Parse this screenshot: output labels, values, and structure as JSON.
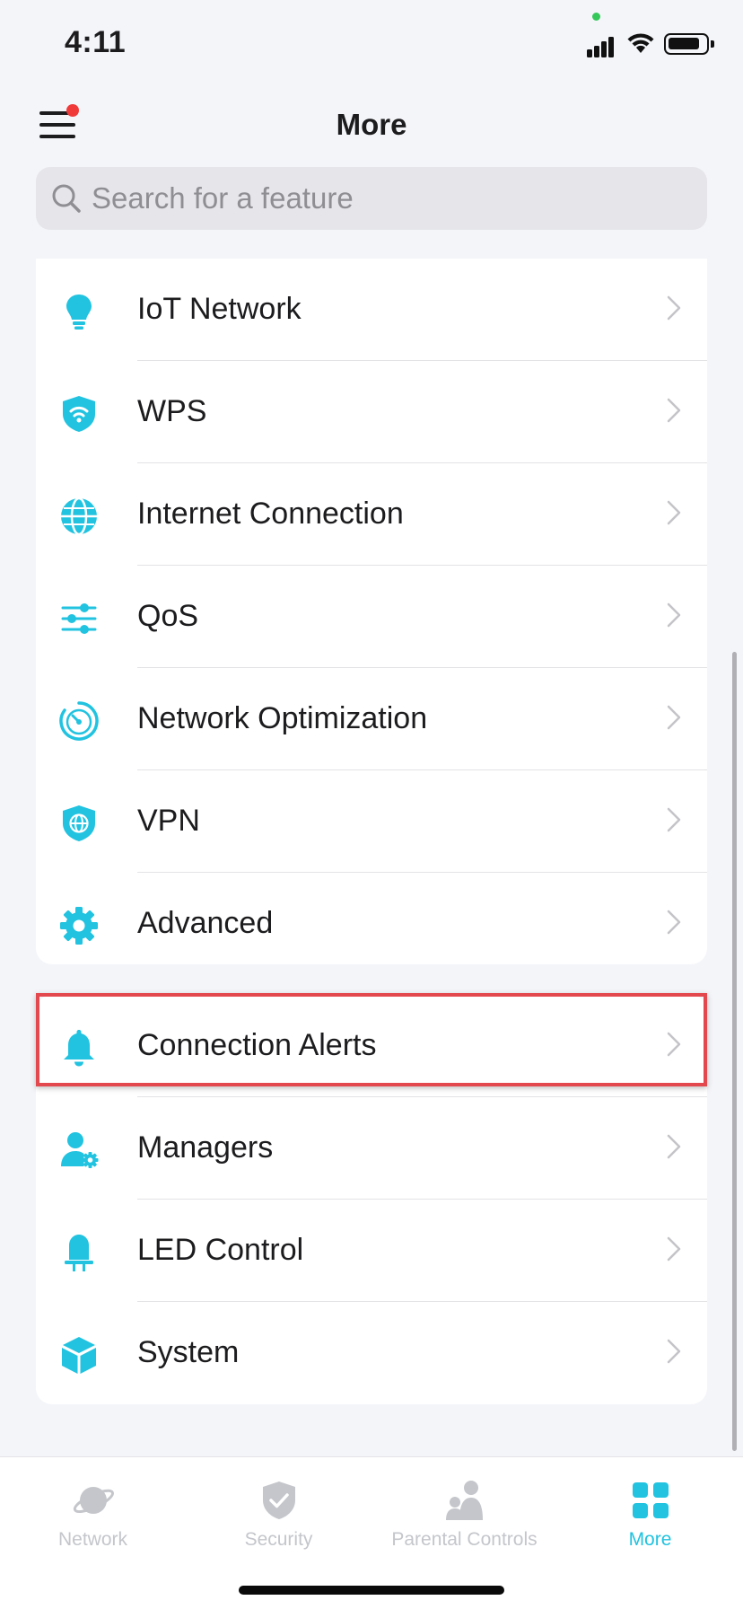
{
  "status_bar": {
    "time": "4:11"
  },
  "header": {
    "title": "More"
  },
  "search": {
    "placeholder": "Search for a feature",
    "value": ""
  },
  "sections": [
    {
      "items": [
        {
          "label": "IoT Network",
          "icon": "bulb-icon"
        },
        {
          "label": "WPS",
          "icon": "wifi-shield-icon"
        },
        {
          "label": "Internet Connection",
          "icon": "globe-icon"
        },
        {
          "label": "QoS",
          "icon": "sliders-icon"
        },
        {
          "label": "Network Optimization",
          "icon": "speed-gauge-icon"
        },
        {
          "label": "VPN",
          "icon": "globe-shield-icon"
        },
        {
          "label": "Advanced",
          "icon": "gear-icon"
        }
      ]
    },
    {
      "items": [
        {
          "label": "Connection Alerts",
          "icon": "bell-icon",
          "highlighted": true
        },
        {
          "label": "Managers",
          "icon": "user-gear-icon"
        },
        {
          "label": "LED Control",
          "icon": "led-icon"
        },
        {
          "label": "System",
          "icon": "cube-icon"
        }
      ]
    }
  ],
  "tabs": [
    {
      "label": "Network",
      "icon": "planet-icon",
      "active": false
    },
    {
      "label": "Security",
      "icon": "shield-check-icon",
      "active": false
    },
    {
      "label": "Parental Controls",
      "icon": "family-icon",
      "active": false
    },
    {
      "label": "More",
      "icon": "grid-icon",
      "active": true
    }
  ],
  "colors": {
    "accent": "#21c3e0",
    "highlight_border": "#e4484f",
    "inactive_tab": "#c4c6cb",
    "badge": "#f03a3a"
  }
}
